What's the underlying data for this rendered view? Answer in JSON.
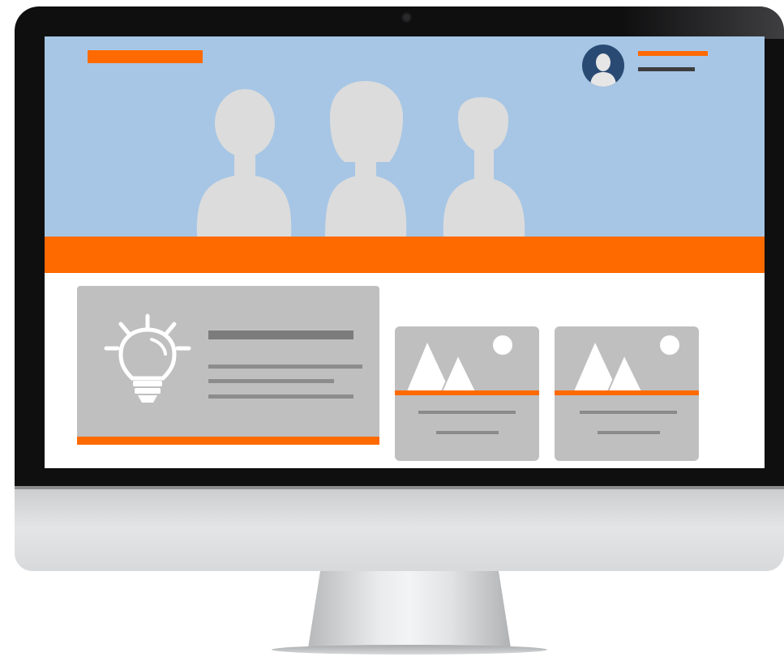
{
  "colors": {
    "accent": "#ff6a00",
    "hero_background": "#a7c6e5",
    "card_background": "#bfbfbf",
    "avatar_background": "#294a73",
    "silhouette": "#dcdcdc",
    "placeholder_line": "#8c8c8c"
  },
  "monitor": {
    "frame": "desktop-monitor"
  },
  "header": {
    "logo": "logo-placeholder-bar",
    "user": {
      "avatar_icon": "user-avatar-icon"
    }
  },
  "hero": {
    "illustration": "team-silhouettes"
  },
  "cards": {
    "feature": {
      "icon": "lightbulb-icon"
    },
    "images": [
      {
        "icon": "image-mountain-icon"
      },
      {
        "icon": "image-mountain-icon"
      }
    ]
  }
}
